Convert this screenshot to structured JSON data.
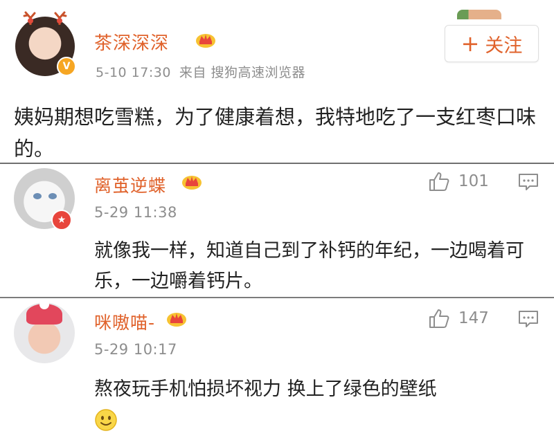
{
  "post": {
    "username": "茶深深深",
    "date": "5-10 17:30",
    "source": "来自 搜狗高速浏览器",
    "follow_label": "关注",
    "content": "姨妈期想吃雪糕，为了健康着想，我特地吃了一支红枣口味的。"
  },
  "comments": [
    {
      "username": "离茧逆蝶",
      "time": "5-29 11:38",
      "likes": "101",
      "text": "就像我一样，知道自己到了补钙的年纪，一边喝着可乐，一边嚼着钙片。"
    },
    {
      "username": "咪嗷喵-",
      "time": "5-29 10:17",
      "likes": "147",
      "text": "熬夜玩手机怕损坏视力 换上了绿色的壁纸"
    }
  ],
  "icons": {
    "crown": "crown-badge-icon",
    "like": "thumbs-up-icon",
    "reply": "comment-bubble-icon",
    "emoji": "smile-emoji-icon",
    "verified": "verified-badge-icon"
  },
  "colors": {
    "username": "#e0622b",
    "meta": "#8d8d8d",
    "verified": "#f6a623",
    "red_badge": "#e8453c"
  }
}
